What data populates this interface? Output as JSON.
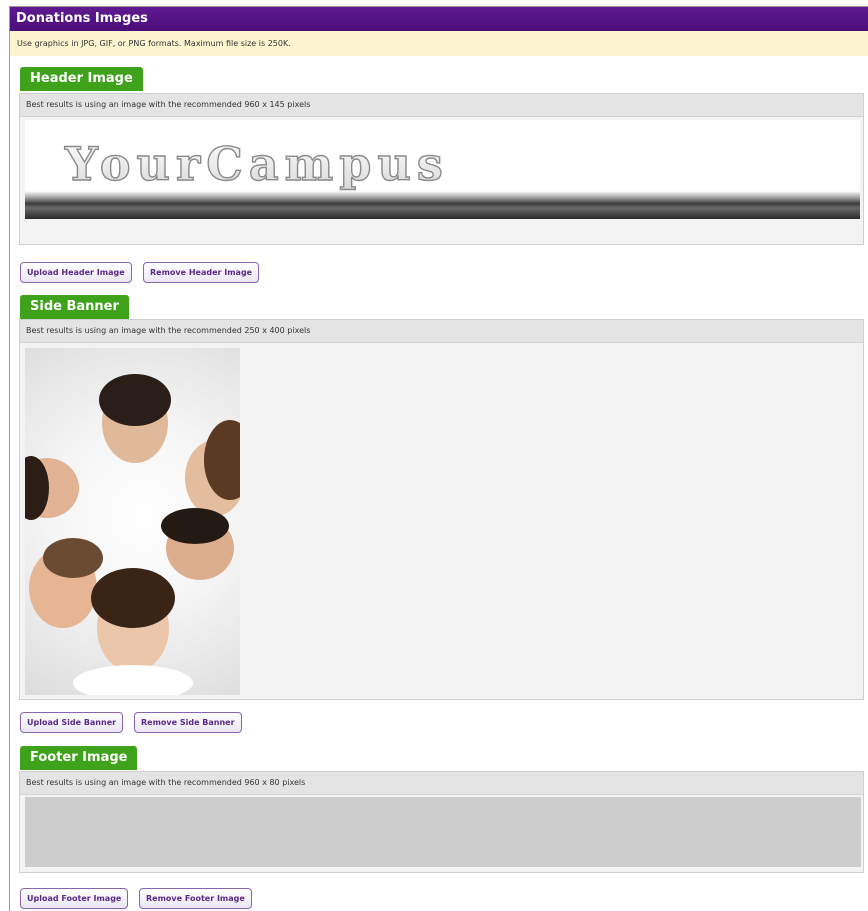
{
  "page": {
    "title": "Donations Images",
    "notice": "Use graphics in JPG, GIF, or PNG formats. Maximum file size is 250K."
  },
  "header_section": {
    "tab": "Header Image",
    "hint": "Best results is using an image with the recommended 960 x 145 pixels",
    "logo_text": "YourCampus",
    "upload_label": "Upload Header Image",
    "remove_label": "Remove Header Image"
  },
  "side_section": {
    "tab": "Side Banner",
    "hint": "Best results is using an image with the recommended 250 x 400 pixels",
    "upload_label": "Upload Side Banner",
    "remove_label": "Remove Side Banner"
  },
  "footer_section": {
    "tab": "Footer Image",
    "hint": "Best results is using an image with the recommended 960 x 80 pixels",
    "upload_label": "Upload Footer Image",
    "remove_label": "Remove Footer Image"
  },
  "colors": {
    "title_bar": "#4b0d7a",
    "tab_green": "#3ea31b",
    "notice_bg": "#fbf4cf",
    "button_text": "#5a2b8a"
  }
}
